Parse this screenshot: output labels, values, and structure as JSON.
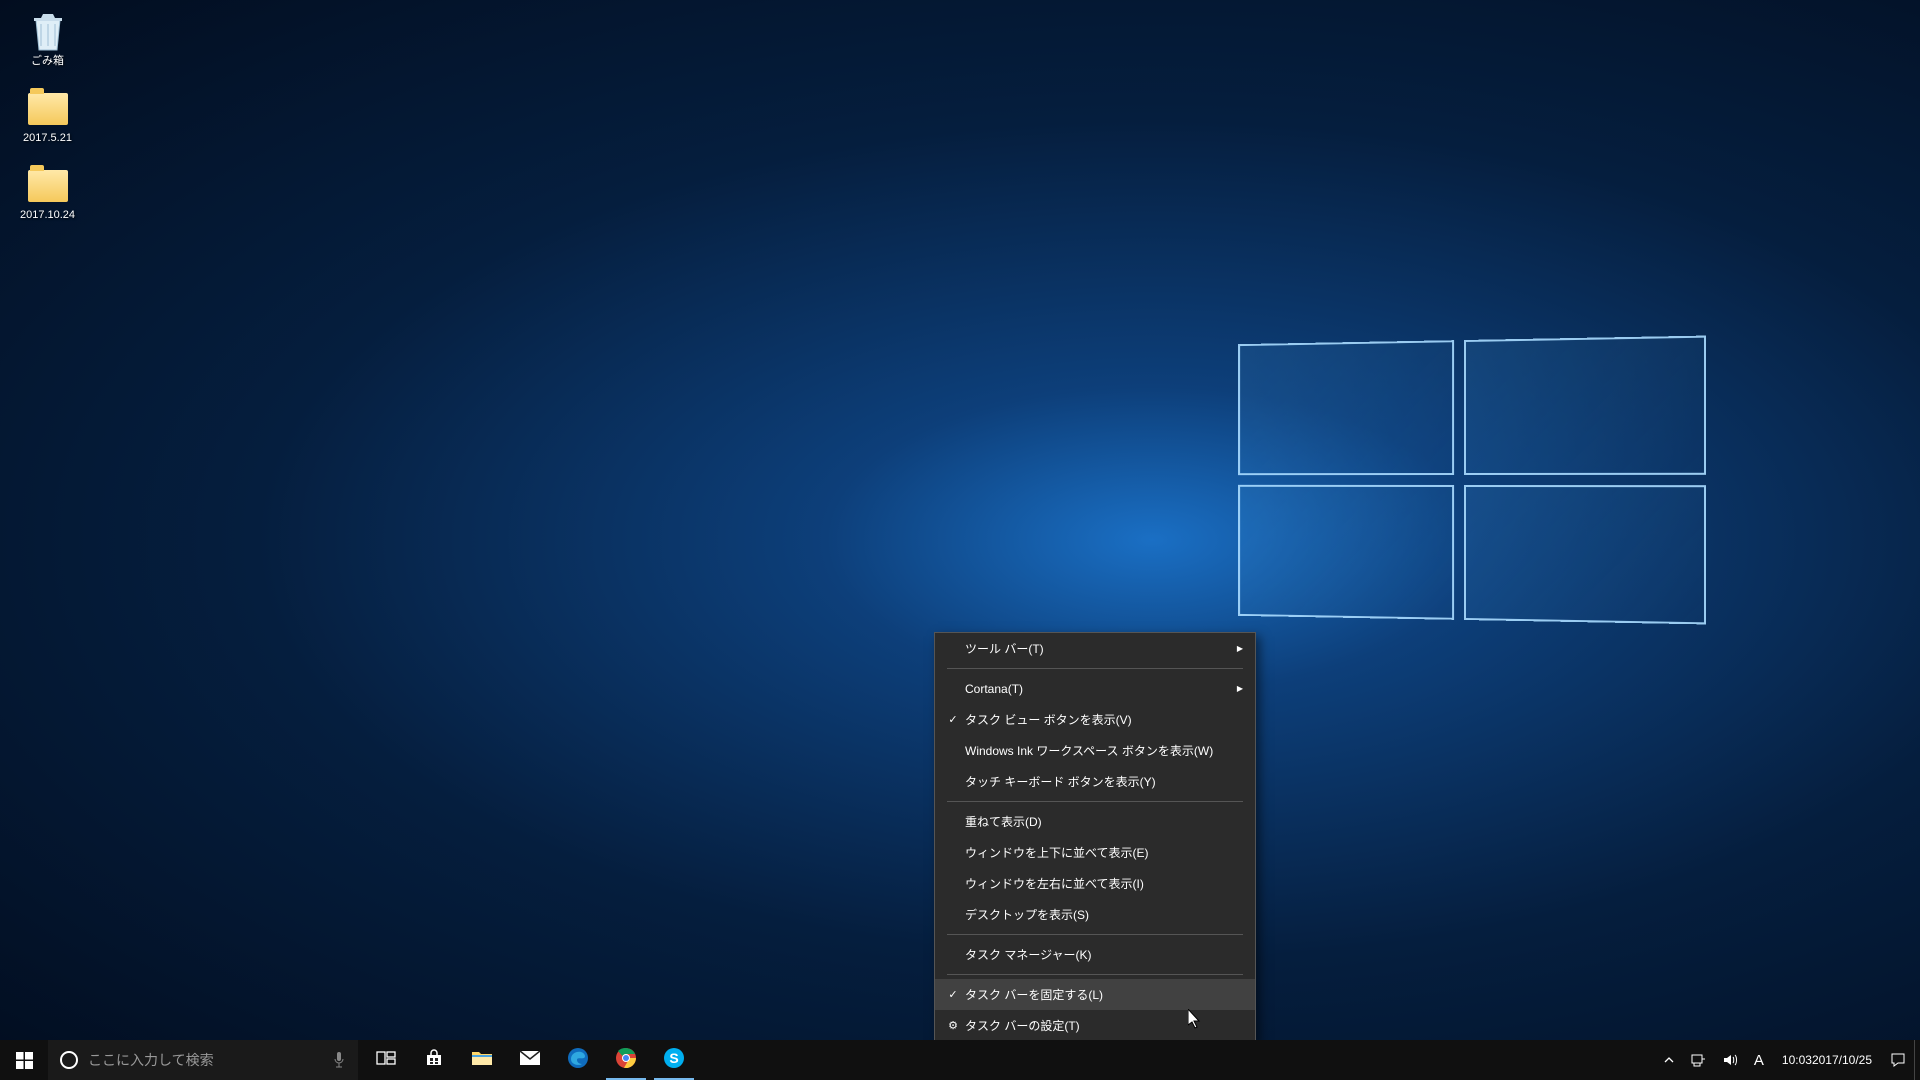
{
  "desktop": {
    "icons": [
      {
        "name": "recycle-bin",
        "label": "ごみ箱"
      },
      {
        "name": "folder-1",
        "label": "2017.5.21"
      },
      {
        "name": "folder-2",
        "label": "2017.10.24"
      }
    ]
  },
  "taskbar": {
    "search_placeholder": "ここに入力して検索",
    "apps": [
      {
        "name": "task-view",
        "active": false
      },
      {
        "name": "store",
        "active": false
      },
      {
        "name": "file-explorer",
        "active": false
      },
      {
        "name": "mail",
        "active": false
      },
      {
        "name": "edge",
        "active": false
      },
      {
        "name": "chrome",
        "active": true
      },
      {
        "name": "skype",
        "active": true
      }
    ]
  },
  "tray": {
    "ime": "A",
    "time": "10:03",
    "date": "2017/10/25"
  },
  "context_menu": {
    "items": [
      {
        "label": "ツール バー(T)",
        "submenu": true
      },
      {
        "sep": true
      },
      {
        "label": "Cortana(T)",
        "submenu": true
      },
      {
        "label": "タスク ビュー ボタンを表示(V)",
        "checked": true
      },
      {
        "label": "Windows Ink ワークスペース ボタンを表示(W)"
      },
      {
        "label": "タッチ キーボード ボタンを表示(Y)"
      },
      {
        "sep": true
      },
      {
        "label": "重ねて表示(D)"
      },
      {
        "label": "ウィンドウを上下に並べて表示(E)"
      },
      {
        "label": "ウィンドウを左右に並べて表示(I)"
      },
      {
        "label": "デスクトップを表示(S)"
      },
      {
        "sep": true
      },
      {
        "label": "タスク マネージャー(K)"
      },
      {
        "sep": true
      },
      {
        "label": "タスク バーを固定する(L)",
        "checked": true,
        "hovered": true
      },
      {
        "label": "タスク バーの設定(T)",
        "icon": "gear"
      }
    ]
  }
}
